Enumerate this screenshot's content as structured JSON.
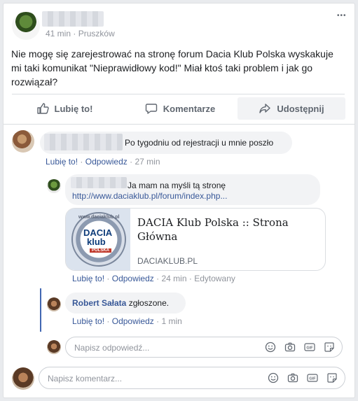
{
  "post": {
    "time": "41 min",
    "separator": "·",
    "location": "Pruszków",
    "text": "Nie mogę się zarejestrować na stronę forum Dacia Klub Polska wyskakuje mi taki komunikat \"Nieprawidłowy kod!\" Miał ktoś taki problem i jak go rozwiązał?",
    "more_label": "•••"
  },
  "actions": {
    "like": "Lubię to!",
    "comment": "Komentarze",
    "share": "Udostępnij"
  },
  "comments": [
    {
      "text": "Po tygodniu od rejestracji u mnie poszło",
      "like": "Lubię to!",
      "reply": "Odpowiedz",
      "time": "27 min"
    }
  ],
  "replies": [
    {
      "text": "Ja mam na myśli tą stronę",
      "url": "http://www.daciaklub.pl/forum/index.php...",
      "preview": {
        "logo_text_top": "www.daciaklub.pl",
        "logo_text_main1": "DACIA",
        "logo_text_main2": "klub",
        "logo_text_sub": "POLSKA",
        "title": "DACIA Klub Polska :: Strona Główna",
        "domain": "DACIAKLUB.PL"
      },
      "like": "Lubię to!",
      "reply": "Odpowiedz",
      "time": "24 min",
      "edited": "Edytowany"
    },
    {
      "author": "Robert Sałata",
      "text": "zgłoszone.",
      "like": "Lubię to!",
      "reply": "Odpowiedz",
      "time": "1 min"
    }
  ],
  "reply_input": {
    "placeholder": "Napisz odpowiedź..."
  },
  "comment_input": {
    "placeholder": "Napisz komentarz..."
  },
  "input_icons": [
    "smiley-icon",
    "camera-icon",
    "gif-icon",
    "sticker-icon"
  ],
  "gif_label": "GIF",
  "colors": {
    "link": "#385898",
    "meta": "#90949c",
    "bubble": "#f2f3f5"
  }
}
